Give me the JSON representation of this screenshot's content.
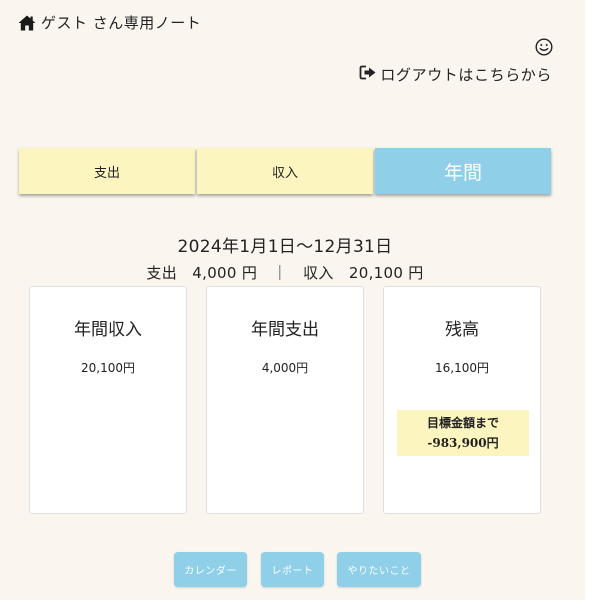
{
  "header": {
    "title": "ゲスト さん専用ノート",
    "logout_label": "ログアウトはこちらから"
  },
  "tabs": [
    {
      "label": "支出",
      "active": false
    },
    {
      "label": "収入",
      "active": false
    },
    {
      "label": "年間",
      "active": true
    }
  ],
  "period": "2024年1月1日〜12月31日",
  "summary": "支出　4,000 円　｜　収入　20,100 円",
  "cards": [
    {
      "title": "年間収入",
      "value": "20,100円"
    },
    {
      "title": "年間支出",
      "value": "4,000円"
    },
    {
      "title": "残高",
      "value": "16,100円",
      "goal_label": "目標金額まで",
      "goal_value": "-983,900円"
    }
  ],
  "buttons": {
    "calendar": "カレンダー",
    "report": "レポート",
    "todo": "やりたいこと"
  },
  "colors": {
    "accent": "#8fcfe8",
    "tab_bg": "#fdf5c0",
    "page_bg": "#faf6ef"
  },
  "icons": [
    "home-icon",
    "smile-icon",
    "logout-icon"
  ]
}
